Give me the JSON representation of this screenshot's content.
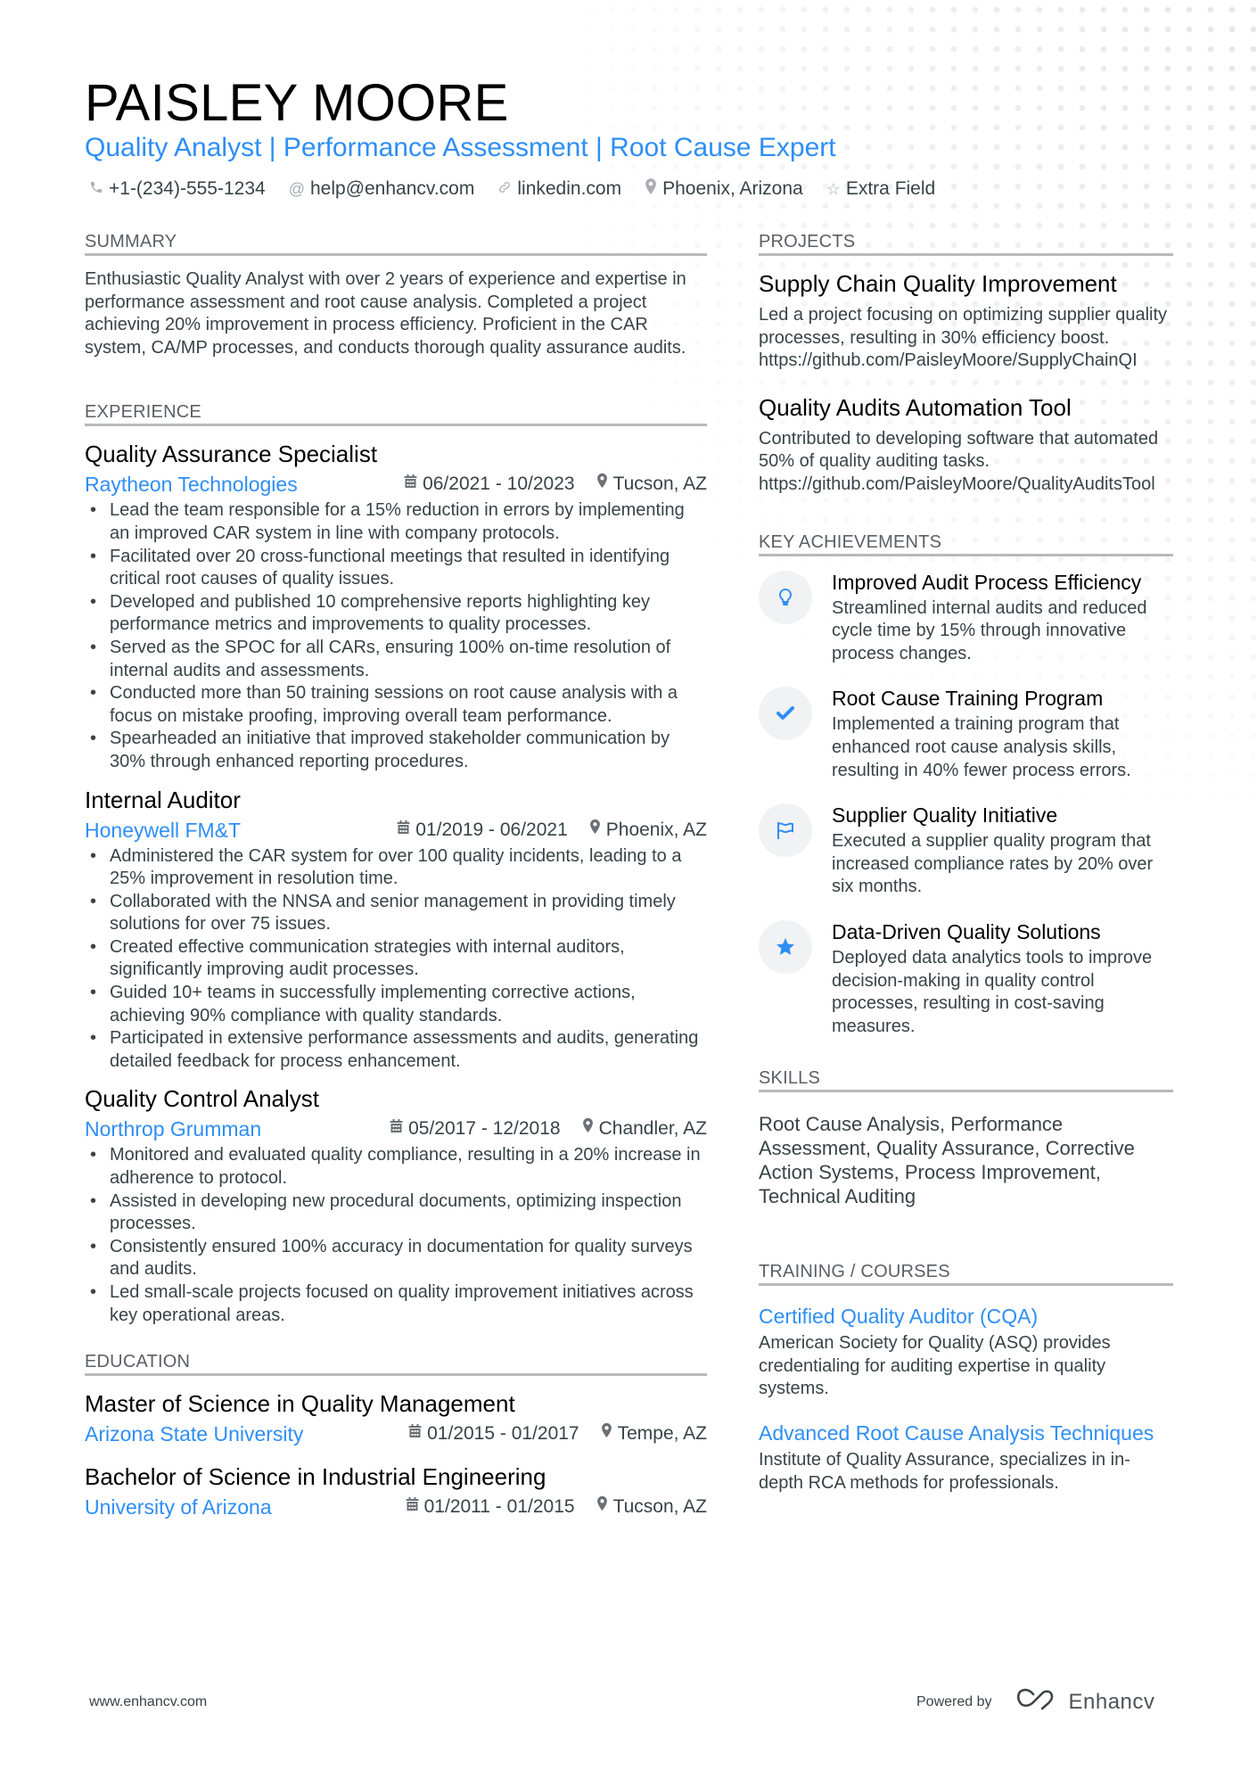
{
  "header": {
    "name": "PAISLEY MOORE",
    "title": "Quality Analyst | Performance Assessment | Root Cause Expert",
    "contacts": [
      {
        "icon": "phone-icon",
        "text": "+1-(234)-555-1234"
      },
      {
        "icon": "at-icon",
        "text": "help@enhancv.com"
      },
      {
        "icon": "link-icon",
        "text": "linkedin.com"
      },
      {
        "icon": "location-pin-icon",
        "text": "Phoenix, Arizona"
      },
      {
        "icon": "star-outline-icon",
        "text": "Extra Field"
      }
    ]
  },
  "summary": {
    "heading": "SUMMARY",
    "text": "Enthusiastic Quality Analyst with over 2 years of experience and expertise in performance assessment and root cause analysis. Completed a project achieving 20% improvement in process efficiency. Proficient in the CAR system, CA/MP processes, and conducts thorough quality assurance audits."
  },
  "experience": {
    "heading": "EXPERIENCE",
    "jobs": [
      {
        "title": "Quality Assurance Specialist",
        "company": "Raytheon Technologies",
        "dates": "06/2021 - 10/2023",
        "location": "Tucson, AZ",
        "bullets": [
          "Lead the team responsible for a 15% reduction in errors by implementing an improved CAR system in line with company protocols.",
          "Facilitated over 20 cross-functional meetings that resulted in identifying critical root causes of quality issues.",
          "Developed and published 10 comprehensive reports highlighting key performance metrics and improvements to quality processes.",
          "Served as the SPOC for all CARs, ensuring 100% on-time resolution of internal audits and assessments.",
          "Conducted more than 50 training sessions on root cause analysis with a focus on mistake proofing, improving overall team performance.",
          "Spearheaded an initiative that improved stakeholder communication by 30% through enhanced reporting procedures."
        ]
      },
      {
        "title": "Internal Auditor",
        "company": "Honeywell FM&T",
        "dates": "01/2019 - 06/2021",
        "location": "Phoenix, AZ",
        "bullets": [
          "Administered the CAR system for over 100 quality incidents, leading to a 25% improvement in resolution time.",
          "Collaborated with the NNSA and senior management in providing timely solutions for over 75 issues.",
          "Created effective communication strategies with internal auditors, significantly improving audit processes.",
          "Guided 10+ teams in successfully implementing corrective actions, achieving 90% compliance with quality standards.",
          "Participated in extensive performance assessments and audits, generating detailed feedback for process enhancement."
        ]
      },
      {
        "title": "Quality Control Analyst",
        "company": "Northrop Grumman",
        "dates": "05/2017 - 12/2018",
        "location": "Chandler, AZ",
        "bullets": [
          "Monitored and evaluated quality compliance, resulting in a 20% increase in adherence to protocol.",
          "Assisted in developing new procedural documents, optimizing inspection processes.",
          "Consistently ensured 100% accuracy in documentation for quality surveys and audits.",
          "Led small-scale projects focused on quality improvement initiatives across key operational areas."
        ]
      }
    ]
  },
  "education": {
    "heading": "EDUCATION",
    "items": [
      {
        "degree": "Master of Science in Quality Management",
        "school": "Arizona State University",
        "dates": "01/2015 - 01/2017",
        "location": "Tempe, AZ"
      },
      {
        "degree": "Bachelor of Science in Industrial Engineering",
        "school": "University of Arizona",
        "dates": "01/2011 - 01/2015",
        "location": "Tucson, AZ"
      }
    ]
  },
  "projects": {
    "heading": "PROJECTS",
    "items": [
      {
        "title": "Supply Chain Quality Improvement",
        "description": "Led a project focusing on optimizing supplier quality processes, resulting in 30% efficiency boost.",
        "link": "https://github.com/PaisleyMoore/SupplyChainQI"
      },
      {
        "title": "Quality Audits Automation Tool",
        "description": "Contributed to developing software that automated 50% of quality auditing tasks.",
        "link": "https://github.com/PaisleyMoore/QualityAuditsTool"
      }
    ]
  },
  "achievements": {
    "heading": "KEY ACHIEVEMENTS",
    "items": [
      {
        "icon": "lightbulb-icon",
        "title": "Improved Audit Process Efficiency",
        "description": "Streamlined internal audits and reduced cycle time by 15% through innovative process changes."
      },
      {
        "icon": "checkmark-icon",
        "title": "Root Cause Training Program",
        "description": "Implemented a training program that enhanced root cause analysis skills, resulting in 40% fewer process errors."
      },
      {
        "icon": "flag-icon",
        "title": "Supplier Quality Initiative",
        "description": "Executed a supplier quality program that increased compliance rates by 20% over six months."
      },
      {
        "icon": "star-icon",
        "title": "Data-Driven Quality Solutions",
        "description": "Deployed data analytics tools to improve decision-making in quality control processes, resulting in cost-saving measures."
      }
    ]
  },
  "skills": {
    "heading": "SKILLS",
    "text": "Root Cause Analysis, Performance Assessment, Quality Assurance, Corrective Action Systems, Process Improvement, Technical Auditing"
  },
  "training": {
    "heading": "TRAINING / COURSES",
    "items": [
      {
        "title": "Certified Quality Auditor (CQA)",
        "description": "American Society for Quality (ASQ) provides credentialing for auditing expertise in quality systems."
      },
      {
        "title": "Advanced Root Cause Analysis Techniques",
        "description": "Institute of Quality Assurance, specializes in in-depth RCA methods for professionals."
      }
    ]
  },
  "footer": {
    "website": "www.enhancv.com",
    "powered_by": "Powered by",
    "brand": "Enhancv"
  },
  "colors": {
    "accent": "#2e8ef5",
    "text": "#384347",
    "heading_rule": "#b6b9bd",
    "icon_bg": "#f1f2f3"
  }
}
